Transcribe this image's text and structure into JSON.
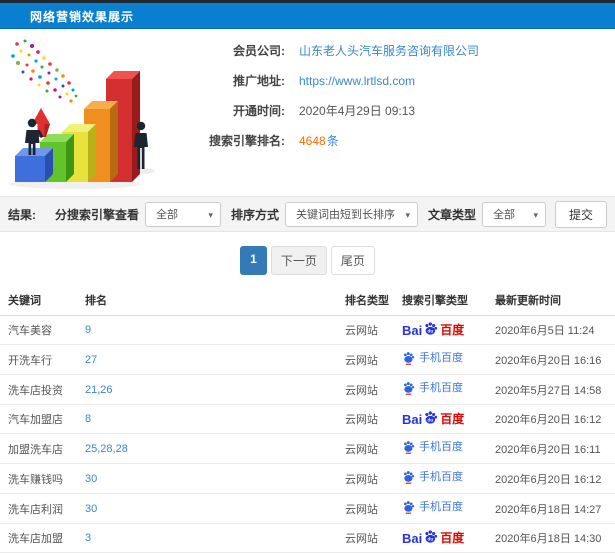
{
  "header": {
    "title": "网络营销效果展示"
  },
  "info": {
    "company": {
      "label": "会员公司:",
      "value": "山东老人头汽车服务咨询有限公司"
    },
    "url": {
      "label": "推广地址:",
      "value": "https://www.lrtlsd.com"
    },
    "opened": {
      "label": "开通时间:",
      "value": "2020年4月29日 09:13"
    },
    "rank": {
      "label": "搜索引擎排名:",
      "count": "4648",
      "unit": "条"
    }
  },
  "filters": {
    "result_label": "结果:",
    "engine": {
      "label": "分搜索引擎查看",
      "value": "全部"
    },
    "sort": {
      "label": "排序方式",
      "value": "关键词由短到长排序"
    },
    "article": {
      "label": "文章类型",
      "value": "全部"
    },
    "submit_label": "提交"
  },
  "pagination": {
    "current": "1",
    "next": "下一页",
    "last": "尾页"
  },
  "table": {
    "headers": [
      "关键词",
      "排名",
      "排名类型",
      "搜索引擎类型",
      "最新更新时间"
    ],
    "rows": [
      {
        "keyword": "汽车美容",
        "rank": "9",
        "rank_type": "云网站",
        "engine": "baidu-pc",
        "updated": "2020年6月5日 11:24"
      },
      {
        "keyword": "开洗车行",
        "rank": "27",
        "rank_type": "云网站",
        "engine": "baidu-mobile",
        "updated": "2020年6月20日 16:16"
      },
      {
        "keyword": "洗车店投资",
        "rank": "21,26",
        "rank_type": "云网站",
        "engine": "baidu-mobile",
        "updated": "2020年5月27日 14:58"
      },
      {
        "keyword": "汽车加盟店",
        "rank": "8",
        "rank_type": "云网站",
        "engine": "baidu-pc",
        "updated": "2020年6月20日 16:12"
      },
      {
        "keyword": "加盟洗车店",
        "rank": "25,28,28",
        "rank_type": "云网站",
        "engine": "baidu-mobile",
        "updated": "2020年6月20日 16:11"
      },
      {
        "keyword": "洗车赚钱吗",
        "rank": "30",
        "rank_type": "云网站",
        "engine": "baidu-mobile",
        "updated": "2020年6月20日 16:12"
      },
      {
        "keyword": "洗车店利润",
        "rank": "30",
        "rank_type": "云网站",
        "engine": "baidu-mobile",
        "updated": "2020年6月18日 14:27"
      },
      {
        "keyword": "洗车店加盟",
        "rank": "3",
        "rank_type": "云网站",
        "engine": "baidu-pc",
        "updated": "2020年6月18日 14:30"
      }
    ],
    "logos": {
      "baidu_pc": {
        "bai": "Bai",
        "suffix": "百度"
      },
      "baidu_mobile": {
        "text": "手机百度"
      }
    }
  },
  "colors": {
    "header_blue": "#0a7fd0",
    "link_blue": "#3a87cd",
    "accent_orange": "#ff6a00",
    "active_page_blue": "#337ab7",
    "baidu_blue": "#2534dd",
    "baidu_red": "#e10601"
  }
}
